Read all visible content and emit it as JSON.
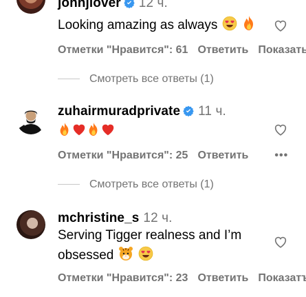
{
  "comments": [
    {
      "username": "johnjlover",
      "time": "12 ч.",
      "text": "Looking amazing as always",
      "likes": "Отметки \"Нравится\": 61",
      "reply": "Ответить",
      "show": "Показать"
    },
    {
      "username": "zuhairmuradprivate",
      "time": "11 ч.",
      "text": "",
      "likes": "Отметки \"Нравится\": 25",
      "reply": "Ответить",
      "more": "•••"
    },
    {
      "username": "mchristine_s",
      "time": "12 ч.",
      "text_line1": "Serving Tigger realness and I’m",
      "text_line2": "obsessed",
      "likes": "Отметки \"Нравится\": 23",
      "reply": "Ответить",
      "show": "Показатъ"
    }
  ],
  "view_replies": [
    "Смотреть все ответы (1)",
    "Смотреть все ответы (1)"
  ],
  "colors": {
    "verified": "#3897f0",
    "meta": "#737373"
  }
}
